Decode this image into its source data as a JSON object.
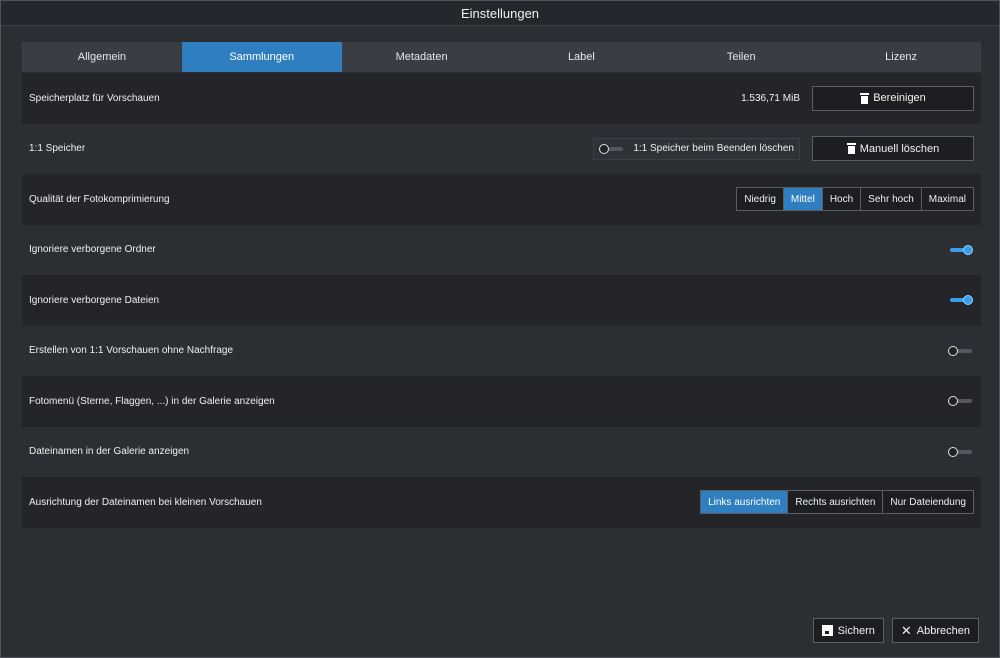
{
  "window": {
    "title": "Einstellungen"
  },
  "tabs": [
    {
      "label": "Allgemein",
      "active": false
    },
    {
      "label": "Sammlungen",
      "active": true
    },
    {
      "label": "Metadaten",
      "active": false
    },
    {
      "label": "Label",
      "active": false
    },
    {
      "label": "Teilen",
      "active": false
    },
    {
      "label": "Lizenz",
      "active": false
    }
  ],
  "preview_storage": {
    "label": "Speicherplatz für Vorschauen",
    "value": "1.536,71 MiB",
    "button_label": "Bereinigen",
    "button_icon": "trash-icon"
  },
  "one_to_one": {
    "label": "1:1 Speicher",
    "toggle_label": "1:1 Speicher beim Beenden löschen",
    "toggle_on": false,
    "button_label": "Manuell löschen",
    "button_icon": "trash-icon"
  },
  "compression": {
    "label": "Qualität der Fotokomprimierung",
    "options": [
      "Niedrig",
      "Mittel",
      "Hoch",
      "Sehr hoch",
      "Maximal"
    ],
    "selected": "Mittel"
  },
  "toggles": [
    {
      "label": "Ignoriere verborgene Ordner",
      "on": true
    },
    {
      "label": "Ignoriere verborgene Dateien",
      "on": true
    },
    {
      "label": "Erstellen von 1:1 Vorschauen ohne Nachfrage",
      "on": false
    },
    {
      "label": "Fotomenü (Sterne, Flaggen, ...) in der Galerie anzeigen",
      "on": false
    },
    {
      "label": "Dateinamen in der Galerie anzeigen",
      "on": false
    }
  ],
  "alignment": {
    "label": "Ausrichtung der Dateinamen bei kleinen Vorschauen",
    "options": [
      "Links ausrichten",
      "Rechts ausrichten",
      "Nur Dateiendung"
    ],
    "selected": "Links ausrichten"
  },
  "footer": {
    "save_label": "Sichern",
    "cancel_label": "Abbrechen",
    "accent_color": "#2f7ec0"
  }
}
